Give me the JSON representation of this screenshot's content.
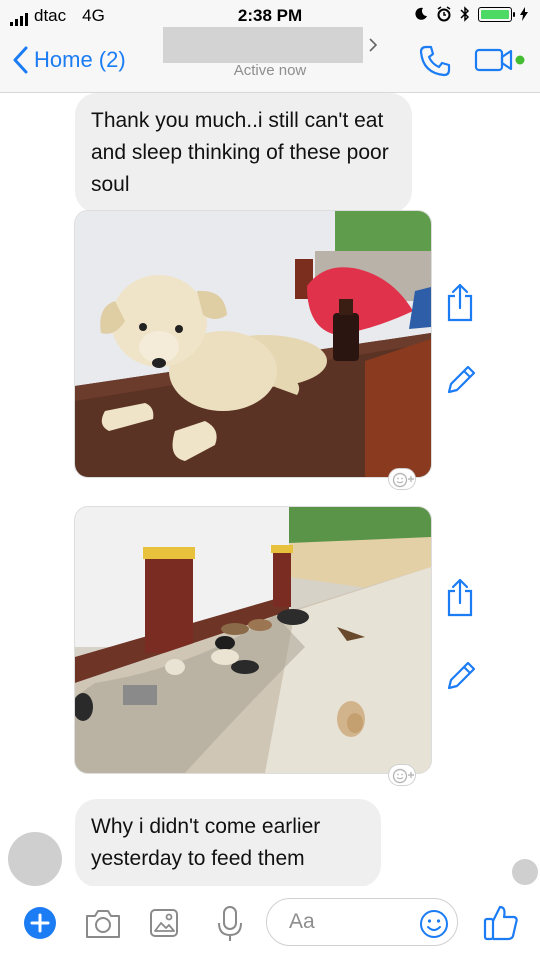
{
  "status_bar": {
    "carrier": "dtac",
    "network": "4G",
    "time": "2:38 PM"
  },
  "header": {
    "back_label": "Home (2)",
    "status": "Active now",
    "icons": [
      "chevron-left-icon",
      "chevron-right-icon",
      "phone-icon",
      "video-camera-icon"
    ]
  },
  "messages": [
    {
      "type": "text",
      "text": "Thank you much..i still can't eat and sleep thinking of these poor soul"
    },
    {
      "type": "image",
      "subject": "photo"
    },
    {
      "type": "image",
      "subject": "photo"
    },
    {
      "type": "text",
      "text": "Why i didn't come earlier yesterday to feed them"
    }
  ],
  "message_actions": [
    "share-icon",
    "edit-icon",
    "add-reaction-icon"
  ],
  "composer": {
    "placeholder": "Aa",
    "icons": [
      "plus-icon",
      "camera-icon",
      "gallery-icon",
      "microphone-icon",
      "emoji-icon",
      "thumbs-up-icon"
    ]
  },
  "colors": {
    "accent": "#1c7cf4",
    "bubble": "#efefef",
    "active_dot": "#44bd32",
    "battery": "#4cd964"
  }
}
